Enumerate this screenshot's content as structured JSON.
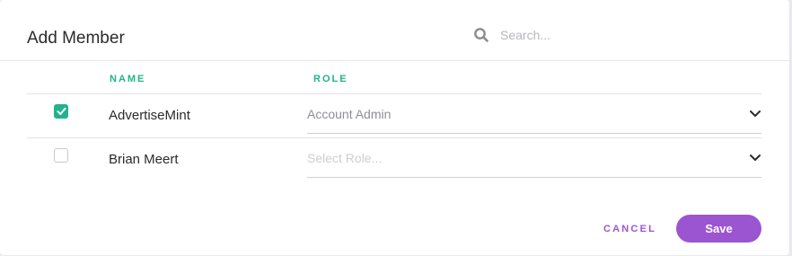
{
  "modal": {
    "title": "Add Member",
    "search": {
      "placeholder": "Search...",
      "icon": "search-icon"
    }
  },
  "table": {
    "headers": {
      "name": "NAME",
      "role": "ROLE"
    },
    "rows": [
      {
        "name": "AdvertiseMint",
        "checked": true,
        "role": "Account Admin",
        "role_is_placeholder": false
      },
      {
        "name": "Brian Meert",
        "checked": false,
        "role": "Select Role...",
        "role_is_placeholder": true
      }
    ]
  },
  "footer": {
    "cancel_label": "CANCEL",
    "save_label": "Save"
  },
  "colors": {
    "accent_green": "#21b38c",
    "accent_purple": "#9b55d1"
  }
}
